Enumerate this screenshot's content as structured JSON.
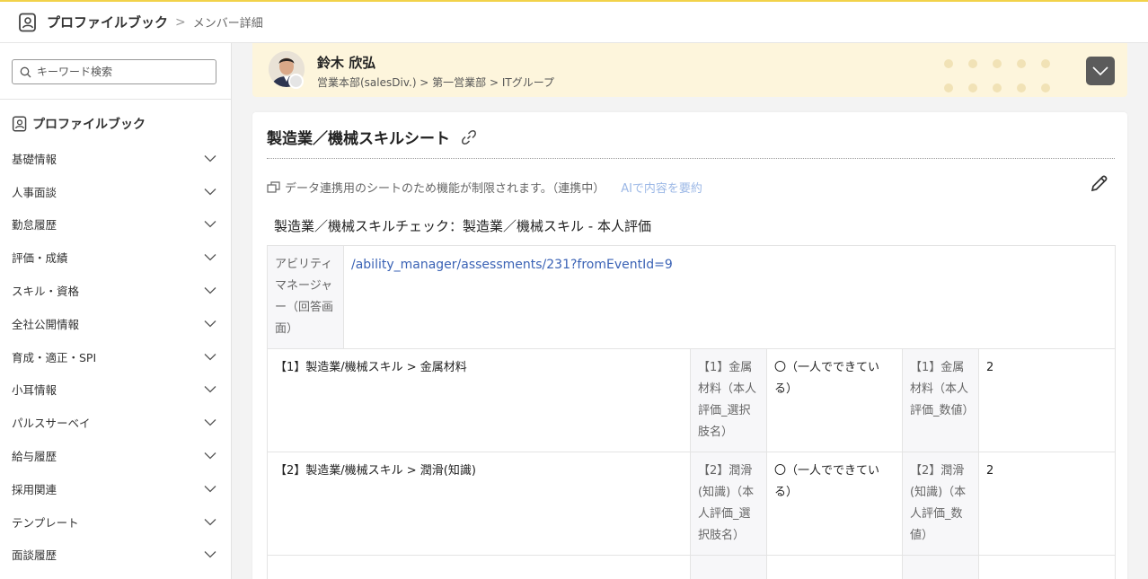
{
  "header": {
    "app_name": "プロファイルブック",
    "separator": ">",
    "current_page": "メンバー詳細"
  },
  "sidebar": {
    "search_placeholder": "キーワード検索",
    "section_title": "プロファイルブック",
    "items": [
      {
        "label": "基礎情報"
      },
      {
        "label": "人事面談"
      },
      {
        "label": "勤怠履歴"
      },
      {
        "label": "評価・成績"
      },
      {
        "label": "スキル・資格"
      },
      {
        "label": "全社公開情報"
      },
      {
        "label": "育成・適正・SPI"
      },
      {
        "label": "小耳情報"
      },
      {
        "label": "パルスサーベイ"
      },
      {
        "label": "給与履歴"
      },
      {
        "label": "採用関連"
      },
      {
        "label": "テンプレート"
      },
      {
        "label": "面談履歴"
      }
    ]
  },
  "profile": {
    "name": "鈴木 欣弘",
    "department": "営業本部(salesDiv.) > 第一営業部 > ITグループ"
  },
  "sheet": {
    "title": "製造業／機械スキルシート",
    "notice": "データ連携用のシートのため機能が制限されます。（連携中）",
    "ai_summary": "AIで内容を要約",
    "subtitle": "製造業／機械スキルチェック：製造業／機械スキル - 本人評価",
    "ability_label": "アビリティマネージャー（回答画面）",
    "ability_url": "/ability_manager/assessments/231?fromEventId=9",
    "rows": [
      {
        "question": "【1】製造業/機械スキル > 金属材料",
        "choice_label": "【1】金属材料（本人評価_選択肢名）",
        "choice_value": "〇（一人でできている）",
        "number_label": "【1】金属材料（本人評価_数値）",
        "number_value": "2"
      },
      {
        "question": "【2】製造業/機械スキル > 潤滑(知識)",
        "choice_label": "【2】潤滑(知識)（本人評価_選択肢名）",
        "choice_value": "〇（一人でできている）",
        "number_label": "【2】潤滑(知識)（本人評価_数値）",
        "number_value": "2"
      }
    ]
  },
  "colors": {
    "accent_yellow": "#f2d24a",
    "profile_bg": "#fdf5dc",
    "link_blue": "#3a62b5",
    "ai_link": "#9cb8e6"
  },
  "icons": {
    "logo": "profile-book-icon",
    "search": "search-icon",
    "chevron": "chevron-down-icon",
    "link": "link-icon",
    "sync": "sync-icon",
    "edit": "pencil-icon"
  }
}
